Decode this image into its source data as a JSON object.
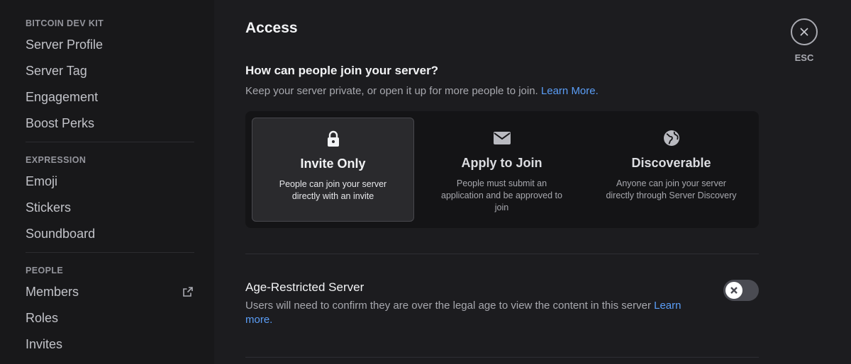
{
  "sidebar": {
    "sections": [
      {
        "header": "BITCOIN DEV KIT",
        "items": [
          "Server Profile",
          "Server Tag",
          "Engagement",
          "Boost Perks"
        ]
      },
      {
        "header": "EXPRESSION",
        "items": [
          "Emoji",
          "Stickers",
          "Soundboard"
        ]
      },
      {
        "header": "PEOPLE",
        "items": [
          "Members",
          "Roles",
          "Invites"
        ]
      }
    ]
  },
  "main": {
    "title": "Access",
    "close": {
      "label": "ESC",
      "icon": "close-icon"
    },
    "join": {
      "question": "How can people join your server?",
      "description": "Keep your server private, or open it up for more people to join.",
      "link": "Learn More.",
      "options": [
        {
          "icon": "lock-icon",
          "title": "Invite Only",
          "description": "People can join your server directly with an invite",
          "selected": true
        },
        {
          "icon": "mail-icon",
          "title": "Apply to Join",
          "description": "People must submit an application and be approved to join",
          "selected": false
        },
        {
          "icon": "globe-icon",
          "title": "Discoverable",
          "description": "Anyone can join your server directly through Server Discovery",
          "selected": false
        }
      ]
    },
    "age_restricted": {
      "title": "Age-Restricted Server",
      "description": "Users will need to confirm they are over the legal age to view the content in this server",
      "link": "Learn more.",
      "enabled": false
    }
  },
  "colors": {
    "background": "#1c1c1f",
    "sidebar": "#18181a",
    "link": "#5b9ef7",
    "toggle_off": "#4a4b52"
  }
}
